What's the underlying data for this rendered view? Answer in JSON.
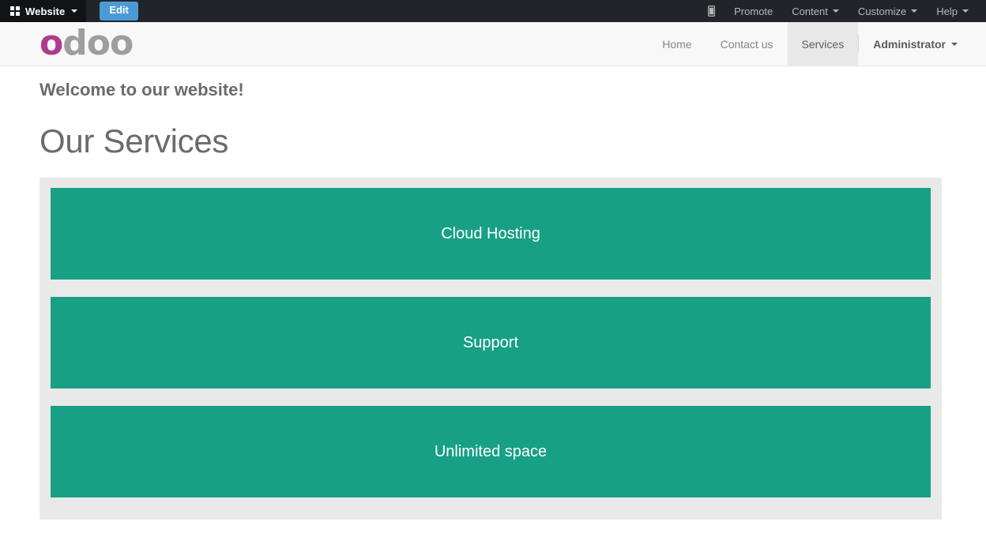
{
  "admin_bar": {
    "apps_menu": {
      "label": "Website",
      "icon": "grid-icon"
    },
    "edit_button": "Edit",
    "right_items": [
      {
        "label": "",
        "icon": "mobile-preview-icon",
        "caret": false
      },
      {
        "label": "Promote",
        "icon": "",
        "caret": false
      },
      {
        "label": "Content",
        "icon": "",
        "caret": true
      },
      {
        "label": "Customize",
        "icon": "",
        "caret": true
      },
      {
        "label": "Help",
        "icon": "",
        "caret": true
      }
    ]
  },
  "site_header": {
    "logo": {
      "first_letter": "o",
      "rest": "doo",
      "accent_color": "#b03a8c",
      "base_color": "#9e9e9e"
    },
    "nav": [
      {
        "label": "Home",
        "active": false
      },
      {
        "label": "Contact us",
        "active": false
      },
      {
        "label": "Services",
        "active": true
      }
    ],
    "user_menu": {
      "label": "Administrator"
    }
  },
  "page": {
    "welcome_heading": "Welcome to our website!",
    "services_heading": "Our Services",
    "service_blocks": [
      {
        "label": "Cloud Hosting",
        "color": "#17a085"
      },
      {
        "label": "Support",
        "color": "#17a085"
      },
      {
        "label": "Unlimited space",
        "color": "#17a085"
      }
    ],
    "panel_background": "#e9e9e9"
  }
}
